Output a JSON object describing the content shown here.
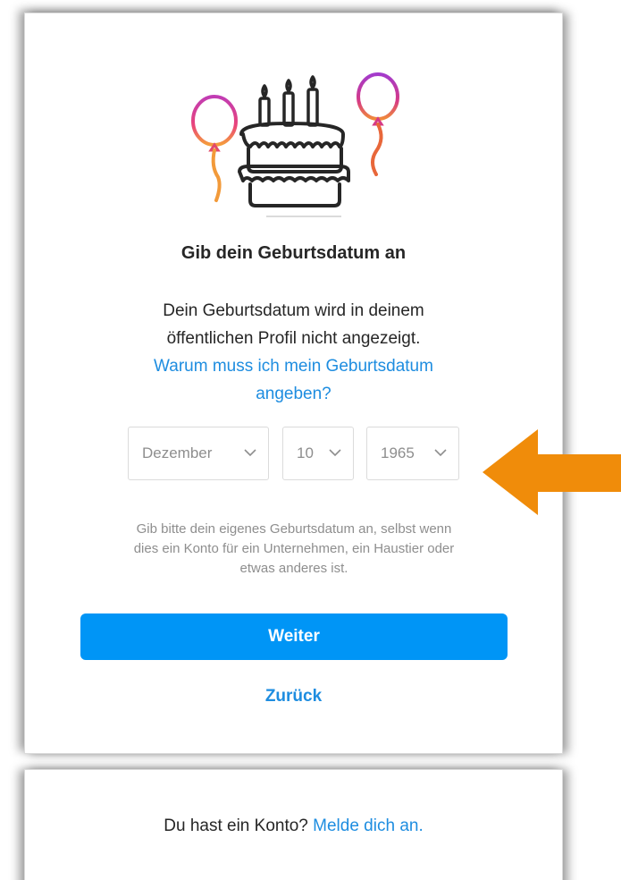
{
  "signup_birthday": {
    "title": "Gib dein Geburtsdatum an",
    "description_line1": "Dein Geburtsdatum wird in deinem",
    "description_line2": "öffentlichen Profil nicht angezeigt.",
    "why_link_line1": "Warum muss ich mein Geburtsdatum",
    "why_link_line2": "angeben?",
    "month_selected": "Dezember",
    "day_selected": "10",
    "year_selected": "1965",
    "hint_line1": "Gib bitte dein eigenes Geburtsdatum an, selbst wenn",
    "hint_line2": "dies ein Konto für ein Unternehmen, ein Haustier oder",
    "hint_line3": "etwas anderes ist.",
    "next_button": "Weiter",
    "back_button": "Zurück"
  },
  "login_prompt": {
    "text": "Du hast ein Konto?",
    "link": "Melde dich an."
  },
  "icons": {
    "illustration": "birthday-cake-balloons-illustration",
    "chevron": "chevron-down-icon",
    "annotation": "orange-arrow-pointer"
  },
  "colors": {
    "primary_button": "#0095f6",
    "link": "#1e8de0",
    "arrow": "#f08c0a",
    "text": "#262626",
    "muted": "#8e8e8e"
  }
}
